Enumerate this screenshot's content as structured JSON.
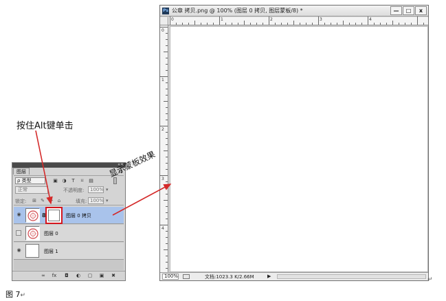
{
  "document_window": {
    "ps_badge": "Ps",
    "title": "公章 拷贝.png @ 100% (图层 0 拷贝, 图层蒙板/8) *",
    "minimize_glyph": "—",
    "restore_glyph": "□",
    "close_glyph": "x",
    "ruler_h_labels": [
      "0",
      "1",
      "2",
      "3",
      "4"
    ],
    "ruler_v_labels": [
      "0",
      "1",
      "2",
      "3",
      "4"
    ],
    "zoom": "100%",
    "doc_info": "文档:1023.3 K/2.66M",
    "status_arrow": "▶"
  },
  "layers_panel": {
    "tab_label": "图层",
    "collapse_glyph": "«×",
    "menu_glyph": "≡",
    "filter_kind": "ρ 类型",
    "filter_icons": [
      "image-icon",
      "circle-half-icon",
      "text-icon",
      "transform-icon",
      "smart-object-icon"
    ],
    "filter_icon_glyphs": [
      "▣",
      "◑",
      "T",
      "⌑",
      "▤"
    ],
    "blend_mode": "正常",
    "opacity_label": "不透明度:",
    "opacity_value": "100%",
    "lock_label": "锁定:",
    "lock_icon_glyphs": [
      "⊞",
      "✎",
      "✛",
      "⌂"
    ],
    "fill_label": "填充:",
    "fill_value": "100%",
    "eye_glyph": "◉",
    "chain_glyph": "8",
    "layers": [
      {
        "name": "图层 0 拷贝",
        "selected": true,
        "visible": true,
        "has_mask": true
      },
      {
        "name": "图层 0",
        "selected": false,
        "visible": false,
        "has_mask": false
      },
      {
        "name": "图层 1",
        "selected": false,
        "visible": true,
        "has_mask": false
      }
    ],
    "footer_glyphs": [
      "∞",
      "fx",
      "◘",
      "◐",
      "▢",
      "▣",
      "✖"
    ]
  },
  "annotations": {
    "alt_click": "按住Alt键单击",
    "show_mask": "显示蒙板效果"
  },
  "caption": "图 7",
  "return_mark": "↵",
  "colors": {
    "annotation_arrow": "#d42a2a",
    "mask_highlight": "#d4141c",
    "selected_layer": "#a9c3eb"
  }
}
